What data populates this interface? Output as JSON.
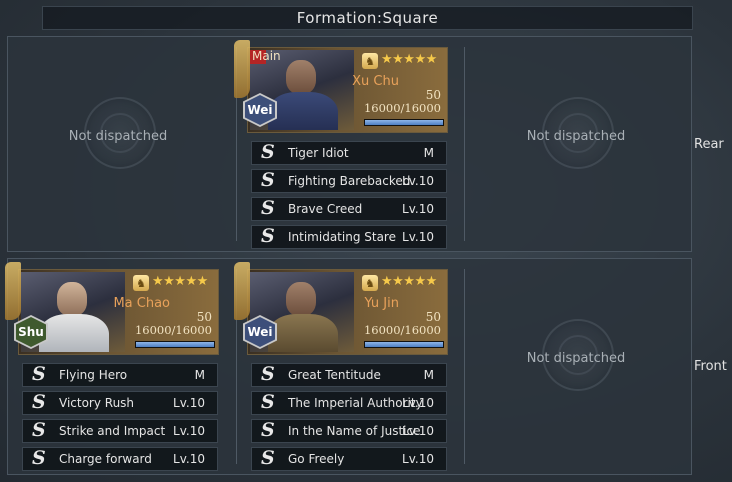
{
  "header": {
    "title": "Formation:Square"
  },
  "rows": {
    "rear_label": "Rear",
    "front_label": "Front"
  },
  "empty_text": "Not dispatched",
  "heroes": {
    "xu_chu": {
      "main_label": "Main",
      "name": "Xu Chu",
      "faction": "Wei",
      "stars": "★★★★★",
      "level": "50",
      "hp": "16000/16000",
      "hp_fraction": 1.0,
      "skills": [
        {
          "name": "Tiger Idiot",
          "level": "M"
        },
        {
          "name": "Fighting Barebacked",
          "level": "Lv.10"
        },
        {
          "name": "Brave Creed",
          "level": "Lv.10"
        },
        {
          "name": "Intimidating Stare",
          "level": "Lv.10"
        }
      ]
    },
    "ma_chao": {
      "name": "Ma Chao",
      "faction": "Shu",
      "stars": "★★★★★",
      "level": "50",
      "hp": "16000/16000",
      "hp_fraction": 1.0,
      "skills": [
        {
          "name": "Flying Hero",
          "level": "M"
        },
        {
          "name": "Victory Rush",
          "level": "Lv.10"
        },
        {
          "name": "Strike and Impact",
          "level": "Lv.10"
        },
        {
          "name": "Charge forward",
          "level": "Lv.10"
        }
      ]
    },
    "yu_jin": {
      "name": "Yu Jin",
      "faction": "Wei",
      "stars": "★★★★★",
      "level": "50",
      "hp": "16000/16000",
      "hp_fraction": 1.0,
      "skills": [
        {
          "name": "Great Tentitude",
          "level": "M"
        },
        {
          "name": "The Imperial Authority",
          "level": "Lv.10"
        },
        {
          "name": "In the Name of Justice",
          "level": "Lv.10"
        },
        {
          "name": "Go Freely",
          "level": "Lv.10"
        }
      ]
    }
  },
  "skill_glyph": "S",
  "crest_glyph": "♞",
  "colors": {
    "wei": "#3d4f7a",
    "shu": "#3f5a2e",
    "hp_fill": "#6f9ad6",
    "name": "#e8a15a"
  }
}
